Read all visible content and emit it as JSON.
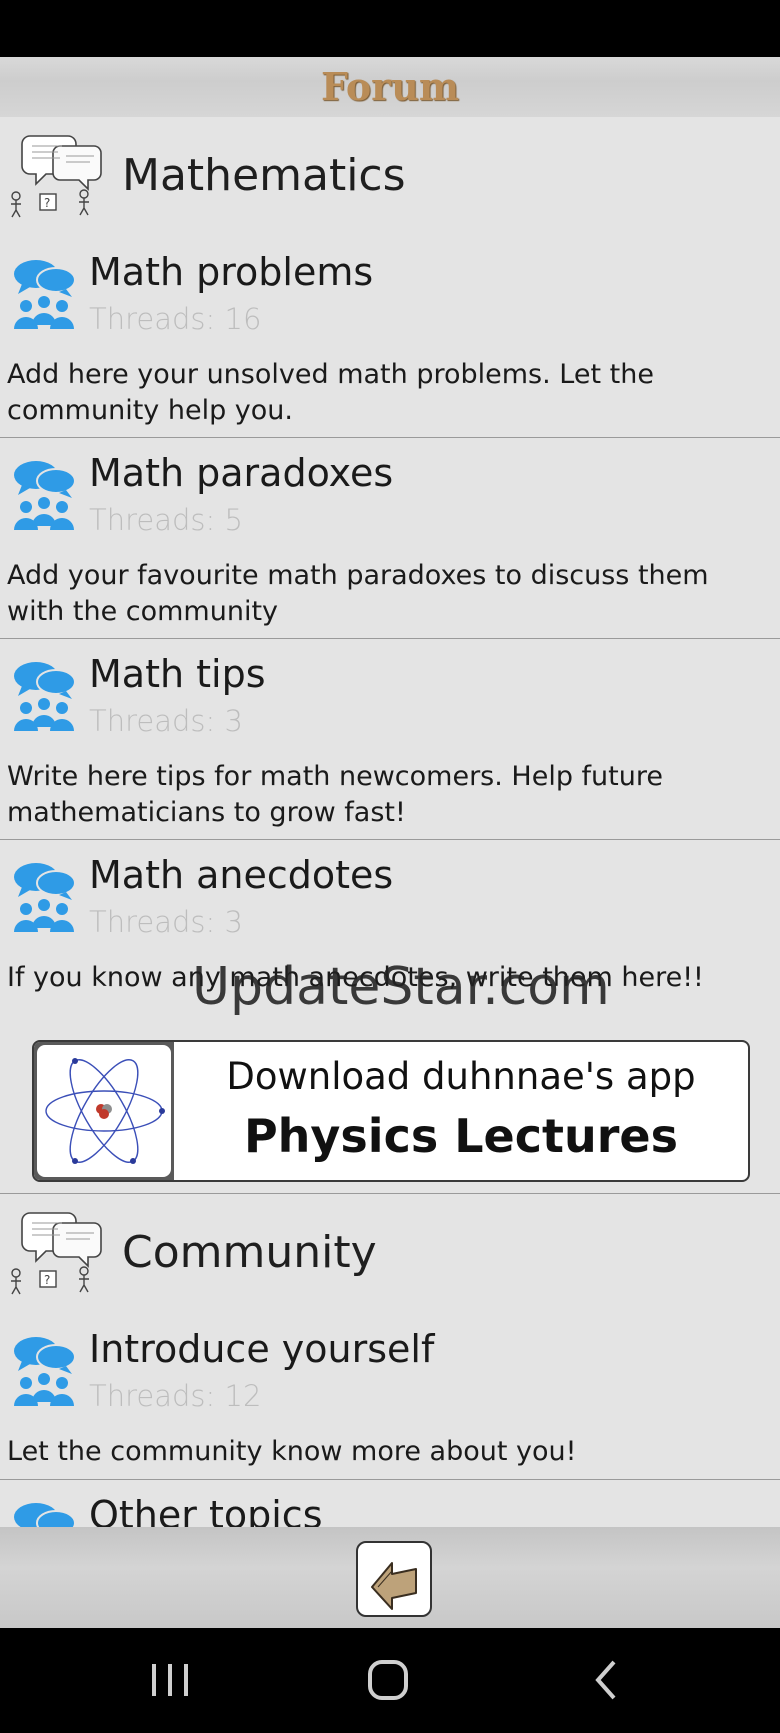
{
  "header": {
    "title": "Forum"
  },
  "sections": [
    {
      "title": "Mathematics",
      "topics": [
        {
          "title": "Math problems",
          "threads": "Threads: 16",
          "description": "Add here your unsolved math problems. Let the community help you."
        },
        {
          "title": "Math paradoxes",
          "threads": "Threads: 5",
          "description": "Add your favourite math paradoxes to discuss them with the community"
        },
        {
          "title": "Math tips",
          "threads": "Threads: 3",
          "description": "Write here tips for math newcomers. Help future mathematicians to grow fast!"
        },
        {
          "title": "Math anecdotes",
          "threads": "Threads: 3",
          "description": "If you know any math anecdotes, write them here!!"
        }
      ]
    },
    {
      "title": "Community",
      "topics": [
        {
          "title": "Introduce yourself",
          "threads": "Threads: 12",
          "description": "Let the community know more about you!"
        },
        {
          "title": "Other topics",
          "threads": "",
          "description": ""
        }
      ]
    }
  ],
  "ad": {
    "line1": "Download duhnnae's app",
    "line2": "Physics Lectures"
  },
  "watermark": "UpdateStar.com",
  "colors": {
    "title": "#b98c57",
    "icon_blue": "#2f9be6",
    "threads": "#bdbdbd",
    "background": "#e4e4e4"
  },
  "icons": {
    "section": "speech-bubbles-icon",
    "topic": "people-group-icon",
    "back": "back-arrow-icon"
  }
}
